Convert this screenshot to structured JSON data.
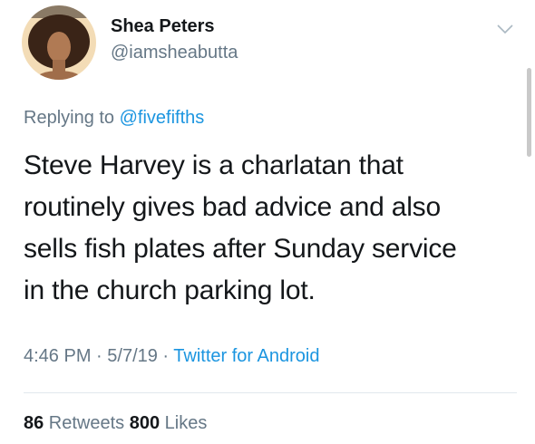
{
  "tweet": {
    "author": {
      "display_name": "Shea Peters",
      "handle": "@iamsheabutta",
      "avatar_icon": "profile-photo"
    },
    "menu_icon": "chevron-down-icon",
    "reply_prefix": "Replying to ",
    "reply_mention": "@fivefifths",
    "text": "Steve Harvey is a charlatan that\nroutinely gives bad advice and also\nsells fish plates after Sunday service\nin the church parking lot.",
    "time": "4:46 PM",
    "date": "5/7/19",
    "separator": " · ",
    "source": "Twitter for Android",
    "retweets_count": "86",
    "retweets_label": " Retweets ",
    "likes_count": "800",
    "likes_label": " Likes"
  },
  "colors": {
    "text": "#14171a",
    "secondary": "#657786",
    "link": "#1b95e0",
    "divider": "#e1e8ed"
  }
}
